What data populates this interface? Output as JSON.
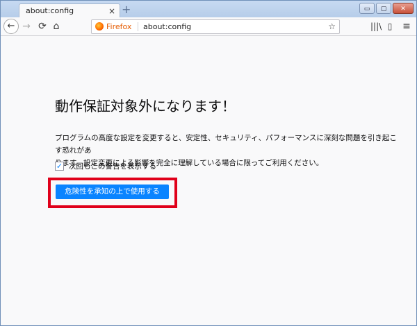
{
  "browser": {
    "tab_title": "about:config",
    "tab_close": "×",
    "new_tab": "+",
    "window_controls": {
      "minimize": "▭",
      "maximize": "▢",
      "close": "✕"
    },
    "nav": {
      "back": "←",
      "forward": "→",
      "reload": "⟳",
      "home": "⌂"
    },
    "url_identity_label": "Firefox",
    "url": "about:config",
    "bookmark_star": "☆",
    "toolbar_right": {
      "library": "|||\\",
      "sidebar": "▯",
      "menu": "≡"
    }
  },
  "page": {
    "headline": "動作保証対象外になります！",
    "warning_line1": "プログラムの高度な設定を変更すると、安定性、セキュリティ、パフォーマンスに深刻な問題を引き起こす恐れがあ",
    "warning_line2": "ります。設定変更による影響を完全に理解している場合に限ってご利用ください。",
    "checkbox_checked": true,
    "checkbox_mark": "✓",
    "checkbox_label": "次回もこの警告を表示する",
    "accept_button": "危険性を承知の上で使用する"
  },
  "colors": {
    "accent": "#0a84ff",
    "highlight_box": "#e0001a",
    "firefox_label": "#e55b00"
  }
}
